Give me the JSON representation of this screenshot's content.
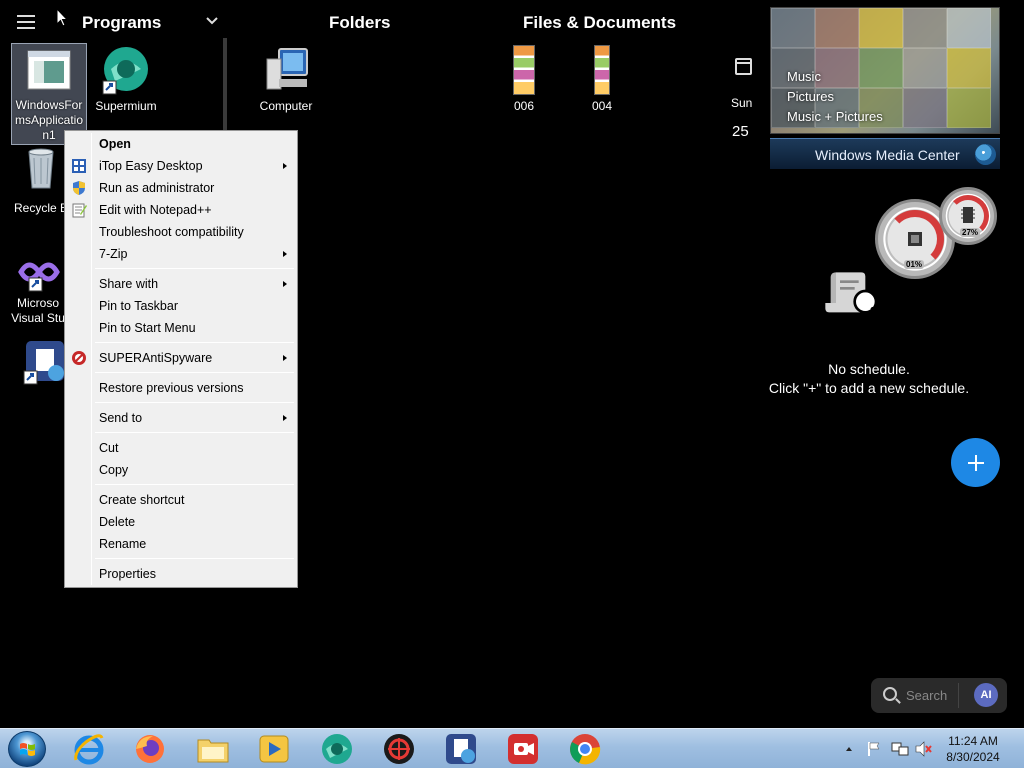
{
  "header": {
    "programs": "Programs",
    "folders": "Folders",
    "files_documents": "Files & Documents"
  },
  "desktop": {
    "icons": [
      {
        "label": "WindowsFormsApplication1",
        "icon": "application-window-icon"
      },
      {
        "label": "Supermium",
        "icon": "supermium-icon"
      },
      {
        "label": "Computer",
        "icon": "computer-icon"
      },
      {
        "label": "006",
        "icon": "image-thumbnail-icon"
      },
      {
        "label": "004",
        "icon": "image-thumbnail-icon"
      },
      {
        "label": "Recycle B",
        "icon": "recycle-bin-icon"
      },
      {
        "label": "Microso Visual Stu",
        "icon": "visual-studio-icon"
      },
      {
        "label": "",
        "icon": "shortcut-app-icon"
      }
    ],
    "label_lines": {
      "app1": [
        "WindowsFor",
        "msApplicatio",
        "n1"
      ],
      "vs": [
        "Microso",
        "Visual Stu"
      ]
    }
  },
  "context_menu": {
    "items": [
      {
        "label": "Open",
        "bold": true
      },
      {
        "label": "iTop Easy Desktop",
        "submenu": true,
        "icon": "itop-easy-desktop-icon"
      },
      {
        "label": "Run as administrator",
        "icon": "uac-shield-icon"
      },
      {
        "label": "Edit with Notepad++",
        "icon": "notepad-plus-plus-icon"
      },
      {
        "label": "Troubleshoot compatibility"
      },
      {
        "label": "7-Zip",
        "submenu": true
      },
      {
        "label": "Share with",
        "submenu": true
      },
      {
        "label": "Pin to Taskbar"
      },
      {
        "label": "Pin to Start Menu"
      },
      {
        "label": "SUPERAntiSpyware",
        "submenu": true,
        "icon": "superantispyware-icon"
      },
      {
        "label": "Restore previous versions"
      },
      {
        "label": "Send to",
        "submenu": true
      },
      {
        "label": "Cut"
      },
      {
        "label": "Copy"
      },
      {
        "label": "Create shortcut"
      },
      {
        "label": "Delete"
      },
      {
        "label": "Rename"
      },
      {
        "label": "Properties"
      }
    ]
  },
  "calendar": {
    "day": "Sun",
    "date": "25"
  },
  "media_center": {
    "items": [
      "Music",
      "Pictures",
      "Music + Pictures"
    ],
    "title": "Windows Media Center"
  },
  "gauges": {
    "cpu_percent": "01%",
    "memory_percent": "27%"
  },
  "schedule": {
    "line1": "No schedule.",
    "line2": "Click \"+\" to add a new schedule."
  },
  "search": {
    "placeholder": "Search",
    "ai_label": "AI"
  },
  "taskbar": {
    "apps": [
      "internet-explorer-icon",
      "firefox-icon",
      "file-explorer-icon",
      "media-player-icon",
      "supermium-icon",
      "capture-tool-icon",
      "remote-desktop-icon",
      "screen-recorder-icon",
      "chrome-icon"
    ],
    "time": "11:24 AM",
    "date": "8/30/2024"
  },
  "colors": {
    "accent_blue": "#1e88e5",
    "menu_bg": "#f0f0f0",
    "taskbar": "#9fbfe1"
  }
}
